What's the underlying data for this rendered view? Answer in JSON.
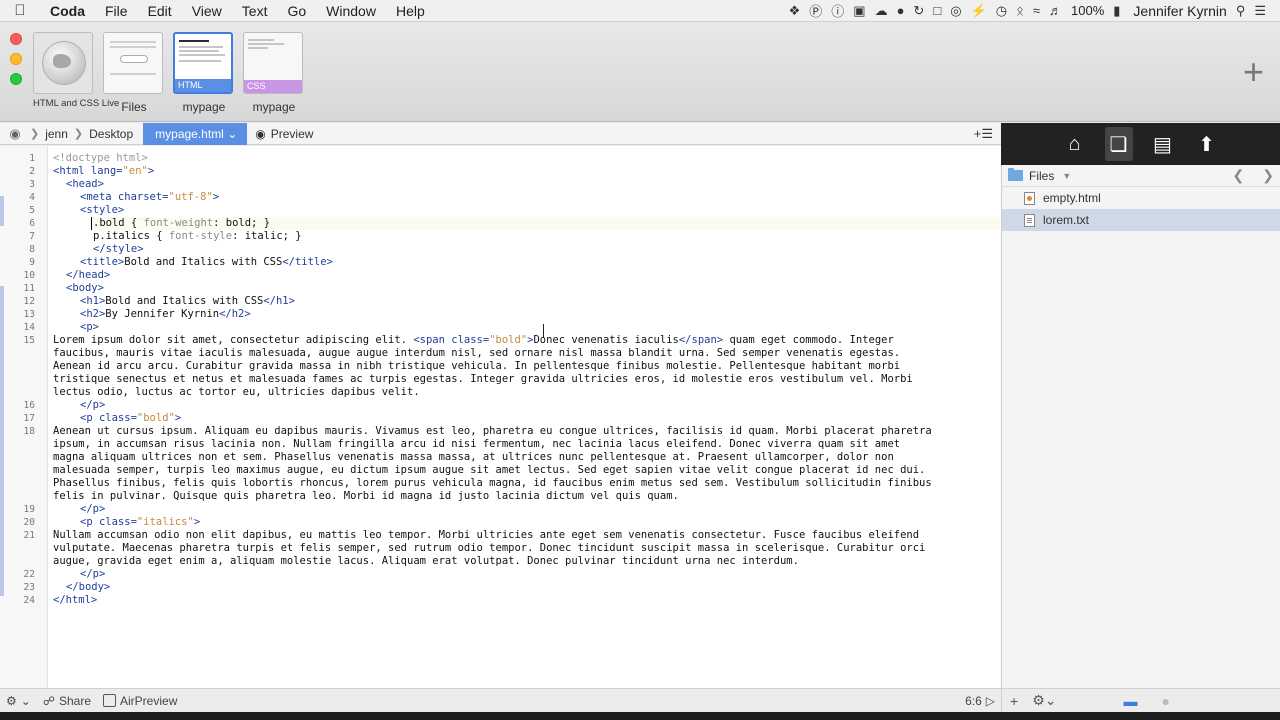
{
  "menubar": {
    "apple_icon": "apple-icon",
    "app_name": "Coda",
    "items": [
      "File",
      "Edit",
      "View",
      "Text",
      "Go",
      "Window",
      "Help"
    ],
    "battery": "100%",
    "user": "Jennifer Kyrnin"
  },
  "toolbar": {
    "sites": [
      {
        "label": "HTML and CSS Live"
      },
      {
        "label": "Files"
      },
      {
        "label": "mypage",
        "tag": "HTML"
      },
      {
        "label": "mypage",
        "tag": "CSS"
      }
    ]
  },
  "pathbar": {
    "crumbs": [
      "jenn",
      "Desktop"
    ],
    "active_file": "mypage.html",
    "preview_label": "Preview"
  },
  "editor": {
    "line_numbers": [
      "1",
      "2",
      "3",
      "4",
      "5",
      "6",
      "7",
      "8",
      "9",
      "10",
      "11",
      "12",
      "13",
      "14",
      "15",
      "16",
      "17",
      "18",
      "19",
      "20",
      "21",
      "22",
      "23",
      "24"
    ],
    "code": {
      "l1": "<!doctype html>",
      "l2_tag": "<html lang=",
      "l2_val": "\"en\"",
      "l2_end": ">",
      "l3": "<head>",
      "l4_tag": "<meta charset=",
      "l4_val": "\"utf-8\"",
      "l4_end": ">",
      "l5": "<style>",
      "l6_sel": ".bold { ",
      "l6_prop": "font-weight",
      "l6_rest": ": bold; }",
      "l7_sel": "p.italics { ",
      "l7_prop": "font-style",
      "l7_rest": ": italic; }",
      "l8": "</style>",
      "l9_open": "<title>",
      "l9_text": "Bold and Italics with CSS",
      "l9_close": "</title>",
      "l10": "</head>",
      "l11": "<body>",
      "l12_open": "<h1>",
      "l12_text": "Bold and Italics with CSS",
      "l12_close": "</h1>",
      "l13_open": "<h2>",
      "l13_text": "By Jennifer Kyrnin",
      "l13_close": "</h2>",
      "l14": "<p>",
      "l15a": "Lorem ipsum dolor sit amet, consectetur adipiscing elit. ",
      "l15a_span": "<span class=",
      "l15a_val": "\"bold\"",
      "l15a_gt": ">",
      "l15a_text": "Donec venenatis iaculis",
      "l15a_close": "</span>",
      "l15a_rest": " quam eget commodo. Integer",
      "l15b": "faucibus, mauris vitae iaculis malesuada, augue augue interdum nisl, sed ornare nisl massa blandit urna. Sed semper venenatis egestas.",
      "l15c": "Aenean id arcu arcu. Curabitur gravida massa in nibh tristique vehicula. In pellentesque finibus molestie. Pellentesque habitant morbi",
      "l15d": "tristique senectus et netus et malesuada fames ac turpis egestas. Integer gravida ultricies eros, id molestie eros vestibulum vel. Morbi",
      "l15e": "lectus odio, luctus ac tortor eu, ultricies dapibus velit.",
      "l16": "</p>",
      "l17_tag": "<p class=",
      "l17_val": "\"bold\"",
      "l17_end": ">",
      "l18a": "Aenean ut cursus ipsum. Aliquam eu dapibus mauris. Vivamus est leo, pharetra eu congue ultrices, facilisis id quam. Morbi placerat pharetra",
      "l18b": "ipsum, in accumsan risus lacinia non. Nullam fringilla arcu id nisi fermentum, nec lacinia lacus eleifend. Donec viverra quam sit amet",
      "l18c": "magna aliquam ultrices non et sem. Phasellus venenatis massa massa, at ultrices nunc pellentesque at. Praesent ullamcorper, dolor non",
      "l18d": "malesuada semper, turpis leo maximus augue, eu dictum ipsum augue sit amet lectus. Sed eget sapien vitae velit congue placerat id nec dui.",
      "l18e": "Phasellus finibus, felis quis lobortis rhoncus, lorem purus vehicula magna, id faucibus enim metus sed sem. Vestibulum sollicitudin finibus",
      "l18f": "felis in pulvinar. Quisque quis pharetra leo. Morbi id magna id justo lacinia dictum vel quis quam.",
      "l19": "</p>",
      "l20_tag": "<p class=",
      "l20_val": "\"italics\"",
      "l20_end": ">",
      "l21a": "Nullam accumsan odio non elit dapibus, eu mattis leo tempor. Morbi ultricies ante eget sem venenatis consectetur. Fusce faucibus eleifend",
      "l21b": "vulputate. Maecenas pharetra turpis et felis semper, sed rutrum odio tempor. Donec tincidunt suscipit massa in scelerisque. Curabitur orci",
      "l21c": "augue, gravida eget enim a, aliquam molestie lacus. Aliquam erat volutpat. Donec pulvinar tincidunt urna nec interdum.",
      "l22": "</p>",
      "l23": "</body>",
      "l24": "</html>"
    }
  },
  "bottombar": {
    "share_label": "Share",
    "airpreview_label": "AirPreview",
    "cursor_position": "6:6"
  },
  "sidebar": {
    "folder_label": "Files",
    "files": [
      "empty.html",
      "lorem.txt"
    ],
    "selected_file": "lorem.txt"
  },
  "colors": {
    "accent": "#5b8fe4",
    "css_tag": "#c996e6",
    "sidebar_dark": "#222222"
  }
}
